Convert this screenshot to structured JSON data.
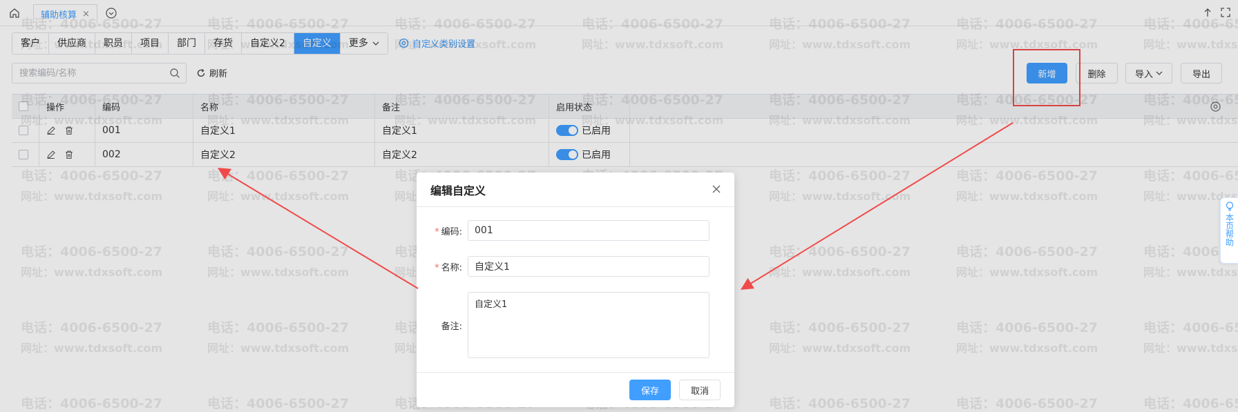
{
  "watermark": {
    "phone": "电话：4006-6500-27",
    "website": "网址：www.tdxsoft.com"
  },
  "topbar": {
    "tab_label": "辅助核算",
    "tab_close": "×"
  },
  "category_tabs": [
    "客户",
    "供应商",
    "职员",
    "项目",
    "部门",
    "存货",
    "自定义2",
    "自定义",
    "更多"
  ],
  "category_active_index": 7,
  "category_settings_label": "自定义类别设置",
  "search": {
    "placeholder": "搜索编码/名称",
    "value": ""
  },
  "refresh_label": "刷新",
  "actions": {
    "add": "新增",
    "delete": "删除",
    "import": "导入",
    "export": "导出"
  },
  "table": {
    "columns": [
      "操作",
      "编码",
      "名称",
      "备注",
      "启用状态"
    ],
    "rows": [
      {
        "code": "001",
        "name": "自定义1",
        "note": "自定义1",
        "status": "已启用"
      },
      {
        "code": "002",
        "name": "自定义2",
        "note": "自定义2",
        "status": "已启用"
      }
    ]
  },
  "dialog": {
    "title": "编辑自定义",
    "fields": {
      "code_label": "编码:",
      "code_value": "001",
      "name_label": "名称:",
      "name_value": "自定义1",
      "note_label": "备注:",
      "note_value": "自定义1"
    },
    "required_mark": "*",
    "save": "保存",
    "cancel": "取消"
  },
  "help_tab": "本页帮助",
  "colors": {
    "primary": "#409eff",
    "annotation_red": "#f04a4a",
    "required": "#f56c6c"
  }
}
